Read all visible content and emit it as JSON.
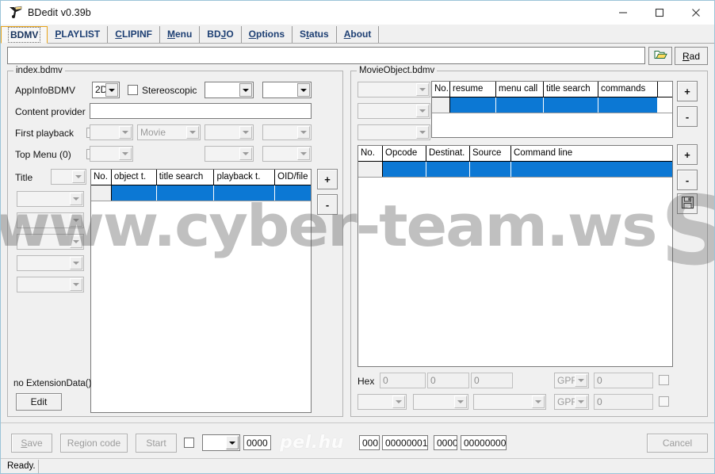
{
  "window": {
    "title": "BDedit v0.39b",
    "icon": "bdedit-app-icon",
    "controls": {
      "minimize": "─",
      "maximize": "☐",
      "close": "✕"
    }
  },
  "tabs": [
    {
      "label": "BDMV",
      "pre": "BDMV",
      "accel": "",
      "post": "",
      "selected": true
    },
    {
      "label": "PLAYLIST",
      "pre": "",
      "accel": "P",
      "post": "LAYLIST",
      "selected": false
    },
    {
      "label": "CLIPINF",
      "pre": "",
      "accel": "C",
      "post": "LIPINF",
      "selected": false
    },
    {
      "label": "Menu",
      "pre": "",
      "accel": "M",
      "post": "enu",
      "selected": false
    },
    {
      "label": "BDJO",
      "pre": "BD",
      "accel": "J",
      "post": "O",
      "selected": false
    },
    {
      "label": "Options",
      "pre": "",
      "accel": "O",
      "post": "ptions",
      "selected": false
    },
    {
      "label": "Status",
      "pre": "S",
      "accel": "t",
      "post": "atus",
      "selected": false
    },
    {
      "label": "About",
      "pre": "",
      "accel": "A",
      "post": "bout",
      "selected": false
    }
  ],
  "pathrow": {
    "path_value": "",
    "path_placeholder": "",
    "open_icon": "folder-open-icon",
    "read_pre": "R",
    "read_accel": "e",
    "read_post": "ad",
    "read_label": "Read"
  },
  "index_panel": {
    "legend": "index.bdmv",
    "appinfo_label": "AppInfoBDMV",
    "appinfo_value": "2D",
    "stereoscopic_label": "Stereoscopic",
    "stereoscopic_checked": false,
    "appinfo_combo2": "",
    "appinfo_combo3": "",
    "content_provider_label": "Content provider",
    "content_provider_value": "",
    "first_playback_label": "First playback",
    "first_playback_checked": false,
    "first_playback_combo1": "",
    "first_playback_combo2": "Movie",
    "first_playback_combo3": "",
    "first_playback_combo4": "",
    "top_menu_label": "Top Menu (0)",
    "top_menu_checked": false,
    "top_menu_combo1": "",
    "top_menu_combo2": "",
    "top_menu_combo3": "",
    "title_label": "Title",
    "title_combo": "",
    "side_combos": [
      "",
      "",
      "",
      "",
      ""
    ],
    "extension_text": "no ExtensionData()",
    "edit_label": "Edit",
    "table": {
      "columns": [
        "No.",
        "object t.",
        "title search",
        "playback t.",
        "OID/file"
      ],
      "rows": [
        {
          "selected": true,
          "cells": [
            "",
            "",
            "",
            "",
            ""
          ]
        }
      ]
    },
    "add_label": "+",
    "del_label": "-"
  },
  "movieobject_panel": {
    "legend": "MovieObject.bdmv",
    "left_combos": [
      "",
      "",
      ""
    ],
    "top_table": {
      "columns": [
        "No.",
        "resume",
        "menu call",
        "title search",
        "commands"
      ],
      "rows": [
        {
          "selected": true,
          "cells": [
            "",
            "",
            "",
            "",
            ""
          ]
        }
      ]
    },
    "top_add_label": "+",
    "top_del_label": "-",
    "cmd_table": {
      "columns": [
        "No.",
        "Opcode",
        "Destinat.",
        "Source",
        "Command line"
      ],
      "rows": [
        {
          "selected": true,
          "cells": [
            "",
            "",
            "",
            "",
            ""
          ]
        }
      ]
    },
    "cmd_add_label": "+",
    "cmd_del_label": "-",
    "save_icon": "floppy-save-icon",
    "hex_label": "Hex",
    "hex_values": [
      "0",
      "0",
      "0"
    ],
    "gpr_row1_label": "GPR",
    "gpr_row1_value": "0",
    "gpr_row1_checked": false,
    "row2_combos": [
      "",
      "",
      ""
    ],
    "gpr_row2_label": "GPR",
    "gpr_row2_value": "0",
    "gpr_row2_checked": false
  },
  "bottombar": {
    "save_pre": "",
    "save_accel": "S",
    "save_post": "ave",
    "save_label": "Save",
    "region_code_label": "Region code",
    "start_label": "Start",
    "checkbox_checked": false,
    "combo_value": "",
    "field_0000": "0000",
    "field_000": "000",
    "field_00000001": "00000001",
    "field_0000b": "0000",
    "field_00000000": "00000000",
    "cancel_label": "Cancel"
  },
  "statusbar": {
    "text": "Ready."
  },
  "watermarks": {
    "main": "www.cyber-team.ws",
    "corner": "S",
    "secondary": "pel.hu"
  },
  "colors": {
    "selection_blue": "#0c78d4",
    "tab_selected_border": "#e8a317",
    "tab_text": "#1d3f73",
    "window_bg": "#f0f0f0",
    "window_border": "#9bc4d8"
  }
}
